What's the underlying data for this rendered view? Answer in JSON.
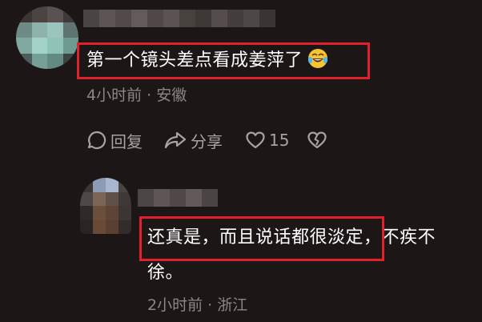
{
  "comment_main": {
    "text": "第一个镜头差点看成姜萍了",
    "emoji": "laughing-crying-emoji",
    "time": "4小时前",
    "separator": "·",
    "location": "安徽",
    "meta": "4小时前 · 安徽"
  },
  "actions": {
    "reply_label": "回复",
    "share_label": "分享",
    "like_count": "15"
  },
  "reply": {
    "text_line1": "还真是，而且说话都很淡定，不疾不",
    "text_line2": "徐。",
    "meta": "2小时前 · 浙江"
  },
  "colors": {
    "background": "#1c1716",
    "highlight": "#e0202a",
    "meta_text": "#8c8785",
    "action_text": "#a8a3a1"
  }
}
